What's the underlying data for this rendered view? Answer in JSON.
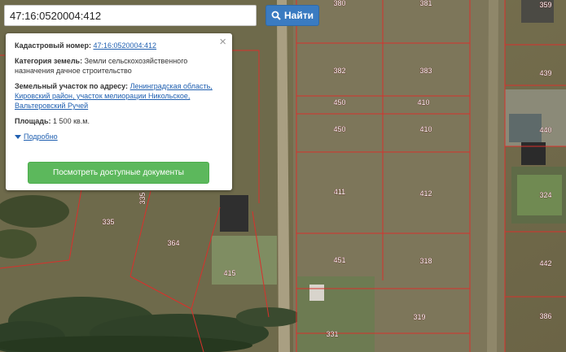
{
  "search": {
    "value": "47:16:0520004:412",
    "button_label": "Найти"
  },
  "popup": {
    "cadastral_label": "Кадастровый номер:",
    "cadastral_value": "47:16:0520004:412",
    "category_label": "Категория земель:",
    "category_value": "Земли сельскохозяйственного назначения дачное строительство",
    "address_label": "Земельный участок по адресу:",
    "address_value": "Ленинградская область, Кировский район, участок мелиорации Никольское, Вальтеровский Ручей",
    "area_label": "Площадь:",
    "area_value": "1 500 кв.м.",
    "more_label": "Подробно",
    "docs_button": "Посмотреть доступные документы",
    "close_symbol": "×"
  },
  "map": {
    "boundary_color": "#d8312c",
    "plot_numbers": [
      "380",
      "381",
      "359",
      "382",
      "383",
      "439",
      "450",
      "410",
      "450",
      "410",
      "440",
      "411",
      "412",
      "324",
      "335",
      "364",
      "335",
      "415",
      "451",
      "318",
      "442",
      "319",
      "386",
      "331"
    ]
  }
}
